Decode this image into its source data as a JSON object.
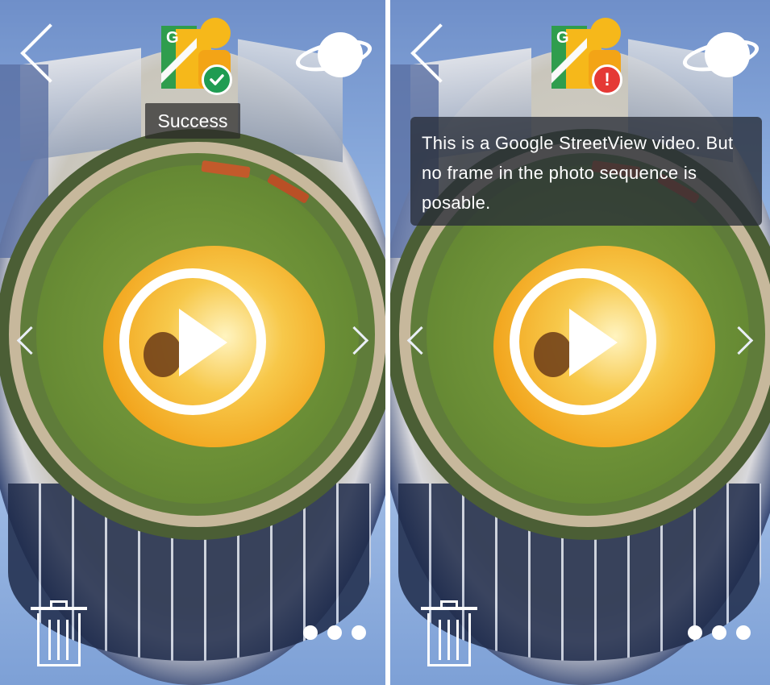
{
  "left_panel": {
    "status_badge": "check",
    "toast": "Success",
    "icons": {
      "back": "back-chevron-icon",
      "app": "google-streetview-icon",
      "sphere": "orbit-sphere-icon",
      "play": "play-icon",
      "prev": "chevron-left-icon",
      "next": "chevron-right-icon",
      "delete": "trash-icon",
      "more": "more-dots-icon"
    }
  },
  "right_panel": {
    "status_badge": "!",
    "toast": "This is a Google StreetView video. But no frame in the photo sequence is posable.",
    "icons": {
      "back": "back-chevron-icon",
      "app": "google-streetview-icon",
      "sphere": "orbit-sphere-icon",
      "play": "play-icon",
      "prev": "chevron-left-icon",
      "next": "chevron-right-icon",
      "delete": "trash-icon",
      "more": "more-dots-icon"
    }
  },
  "app_icon_letter": "G",
  "colors": {
    "success": "#1f9c52",
    "error": "#e53935",
    "streetview_green": "#2f9d4d",
    "streetview_yellow": "#f6b81a"
  }
}
